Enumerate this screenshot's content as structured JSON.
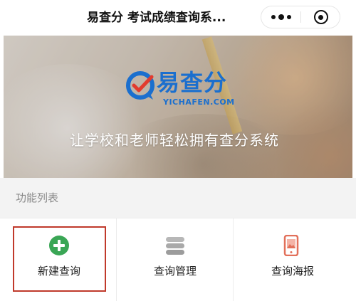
{
  "navbar": {
    "title": "易查分 考试成绩查询系..."
  },
  "banner": {
    "logo_text": "易查分",
    "logo_sub": "YICHAFEN.COM",
    "slogan": "让学校和老师轻松拥有查分系统"
  },
  "section": {
    "label": "功能列表"
  },
  "features": [
    {
      "label": "新建查询",
      "icon": "plus-circle-icon",
      "color": "#3aa655"
    },
    {
      "label": "查询管理",
      "icon": "database-icon",
      "color": "#b7b7b7"
    },
    {
      "label": "查询海报",
      "icon": "phone-poster-icon",
      "color": "#e2705a"
    }
  ],
  "colors": {
    "brand": "#1b6fce",
    "highlight_border": "#c0392b"
  }
}
